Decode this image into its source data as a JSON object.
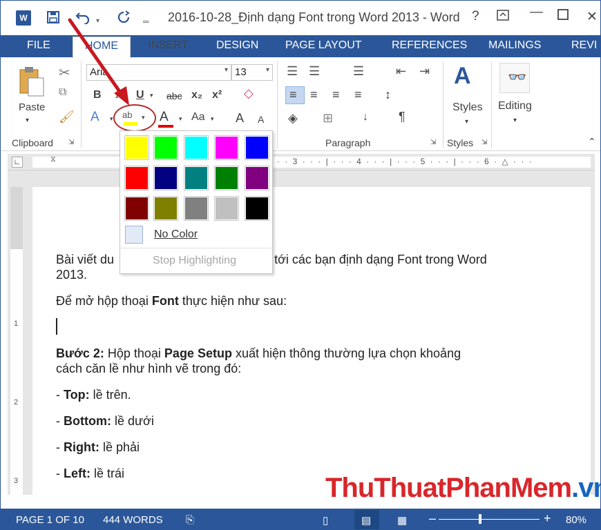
{
  "window": {
    "title": "2016-10-28_Định dạng Font trong Word 2013 - Word",
    "help": "?",
    "word_logo": "W"
  },
  "tabs": [
    "FILE",
    "HOME",
    "INSERT",
    "DESIGN",
    "PAGE LAYOUT",
    "REFERENCES",
    "MAILINGS",
    "REVI"
  ],
  "ribbon": {
    "clipboard": {
      "paste_label": "Paste",
      "group_label": "Clipboard"
    },
    "font": {
      "font_name": "Aria",
      "font_size": "13",
      "bold": "B",
      "italic": "I",
      "underline": "U",
      "strike": "abc",
      "subscript": "x₂",
      "superscript": "x²",
      "text_effects": "A",
      "highlight": "ab",
      "font_color": "A",
      "change_case": "Aa",
      "grow": "A",
      "shrink": "A"
    },
    "paragraph": {
      "group_label": "Paragraph",
      "pilcrow": "¶"
    },
    "styles": {
      "label": "Styles",
      "group_label": "Styles"
    },
    "editing": {
      "label": "Editing"
    }
  },
  "ruler_numbers": [
    "3",
    "4",
    "5",
    "6"
  ],
  "vruler_numbers": [
    "1",
    "2",
    "3"
  ],
  "color_picker": {
    "colors": [
      [
        "#ffff00",
        "#00ff00",
        "#00ffff",
        "#ff00ff",
        "#0000ff"
      ],
      [
        "#ff0000",
        "#000080",
        "#008080",
        "#008000",
        "#800080"
      ],
      [
        "#800000",
        "#808000",
        "#808080",
        "#c0c0c0",
        "#000000"
      ]
    ],
    "no_color": "No Color",
    "stop_highlighting": "Stop Highlighting"
  },
  "document": {
    "p1_start": "Bài viết du",
    "p1_end": "t tới các bạn định dạng Font trong Word",
    "p1_line2": "2013.",
    "p2_pre": "Để mở hộp thoại ",
    "p2_bold": "Font",
    "p2_post": " thực hiện như sau:",
    "p3_bold1": "Bước 2:",
    "p3_mid": " Hộp thoại ",
    "p3_bold2": "Page Setup",
    "p3_post": " xuất hiện thông thường lựa chọn khoảng",
    "p3_line2": "cách căn lề như hình vẽ trong đó:",
    "items": [
      {
        "dash": "- ",
        "label": "Top:",
        "text": " lề trên."
      },
      {
        "dash": "- ",
        "label": "Bottom:",
        "text": " lề dưới"
      },
      {
        "dash": "- ",
        "label": "Right:",
        "text": " lề phải"
      },
      {
        "dash": "- ",
        "label": "Left:",
        "text": " lề trái"
      }
    ]
  },
  "status": {
    "page": "PAGE 1 OF 10",
    "words": "444 WORDS",
    "zoom": "80%",
    "minus": "–",
    "plus": "+"
  },
  "watermark": {
    "part1": "ThuThuat",
    "part2": "PhanMem",
    "part3": ".vn",
    "color1": "#d9262a",
    "color2": "#1565c0"
  },
  "colors": {
    "accent": "#2b579a",
    "arrow": "#c8191f"
  }
}
